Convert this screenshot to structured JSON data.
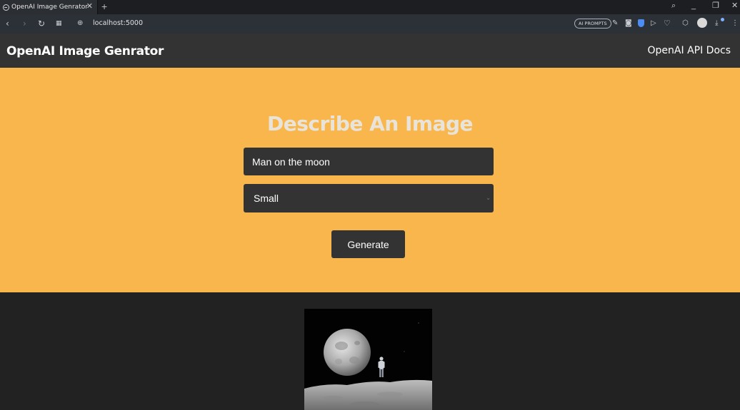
{
  "browser": {
    "tab_title": "OpenAI Image Genrator",
    "tab_close": "✕",
    "new_tab": "+",
    "url": "localhost:5000",
    "ai_prompts_label": "AI PROMPTS",
    "accent": "#4b8df2"
  },
  "header": {
    "brand": "OpenAI Image Genrator",
    "docs_link": "OpenAI API Docs"
  },
  "hero": {
    "title": "Describe An Image",
    "prompt_value": "Man on the moon",
    "size_selected": "Small",
    "generate_label": "Generate",
    "background": "#f8b64c"
  },
  "result": {
    "image_alt": "Man on the moon"
  }
}
